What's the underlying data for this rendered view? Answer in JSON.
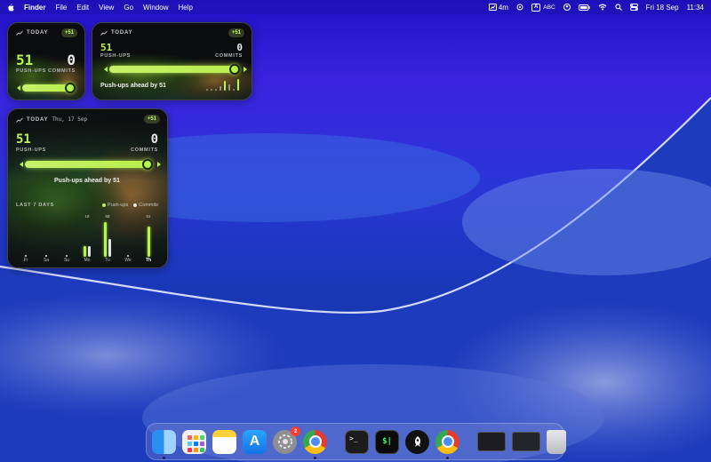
{
  "menubar": {
    "apple_icon": "apple-logo",
    "app_name": "Finder",
    "menus": [
      "File",
      "Edit",
      "View",
      "Go",
      "Window",
      "Help"
    ],
    "status": {
      "timer": "4m",
      "input_source": "ABC",
      "date": "Fri 18 Sep",
      "time": "11:34"
    }
  },
  "widget_small": {
    "header": "TODAY",
    "delta": "+51",
    "pushups": "51",
    "commits": "0",
    "pushups_label": "PUSH-UPS",
    "commits_label": "COMMITS",
    "balance": 0.85
  },
  "widget_medium": {
    "header": "TODAY",
    "delta": "+51",
    "pushups": "51",
    "commits": "0",
    "pushups_label": "PUSH-UPS",
    "commits_label": "COMMITS",
    "message": "Push-ups ahead by 51",
    "balance": 0.95
  },
  "widget_large": {
    "header": "TODAY",
    "date": "Thu, 17 Sep",
    "delta": "+51",
    "pushups": "51",
    "commits": "0",
    "pushups_label": "PUSH-UPS",
    "commits_label": "COMMITS",
    "message": "Push-ups ahead by 51",
    "balance": 0.93,
    "chart_title": "LAST 7 DAYS",
    "legend_pushups": "Push-ups",
    "legend_commits": "Commits",
    "colors": {
      "pushups": "#b6f54c",
      "commits": "#e4e4e4"
    },
    "days": [
      {
        "label": "Fr",
        "pushups": 0,
        "commits": 1,
        "value_text": ""
      },
      {
        "label": "Sa",
        "pushups": 0,
        "commits": 1,
        "value_text": ""
      },
      {
        "label": "Su",
        "pushups": 0,
        "commits": 1,
        "value_text": ""
      },
      {
        "label": "Mo",
        "pushups": 18,
        "commits": 18,
        "value_text": "18"
      },
      {
        "label": "Tu",
        "pushups": 58,
        "commits": 30,
        "value_text": "58"
      },
      {
        "label": "We",
        "pushups": 0,
        "commits": 1,
        "value_text": ""
      },
      {
        "label": "Th",
        "pushups": 51,
        "commits": 0,
        "value_text": "51"
      }
    ]
  },
  "dock": {
    "apps": [
      "finder-icon",
      "launchpad-icon",
      "notes-icon",
      "app-store-icon",
      "system-settings-icon",
      "chrome-icon",
      "terminal-icon",
      "terminal-green-icon",
      "rocket-icon",
      "chrome-icon"
    ],
    "settings_badge": "2",
    "terminal_text": ">_",
    "terminal2_text": "$|",
    "appstore_glyph": "A"
  }
}
